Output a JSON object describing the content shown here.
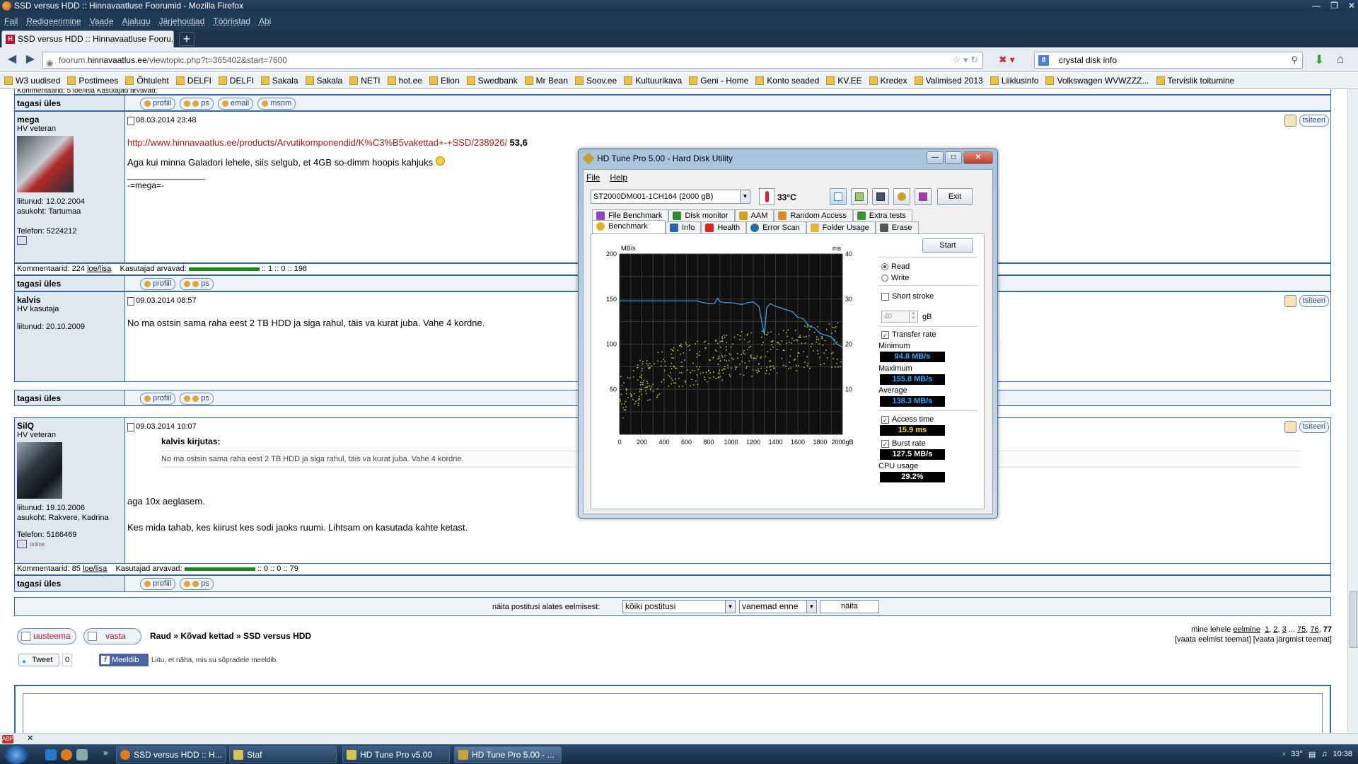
{
  "browser": {
    "title": "SSD versus HDD :: Hinnavaatluse Foorumid - Mozilla Firefox",
    "menu": [
      "Fail",
      "Redigeerimine",
      "Vaade",
      "Ajalugu",
      "Järjehoidjad",
      "Tööriistad",
      "Abi"
    ],
    "tab_title": "SSD versus HDD :: Hinnavaatluse Fooru...",
    "url_prefix": "foorum.",
    "url_domain": "hinnavaatlus.ee",
    "url_rest": "/viewtopic.php?t=365402&start=7600",
    "search_engine": "8",
    "search_text": "crystal disk info",
    "bookmarks": [
      "W3 uudised",
      "Postimees",
      "Õhtuleht",
      "DELFI",
      "DELFI",
      "Sakala",
      "Sakala",
      "NETI",
      "hot.ee",
      "Elion",
      "Swedbank",
      "Mr Bean",
      "Soov.ee",
      "Kultuurikava",
      "Geni - Home",
      "Konto seaded",
      "KV.EE",
      "Kredex",
      "Valimised 2013",
      "Liiklusinfo",
      "Volkswagen WVWZZZ...",
      "Tervislik toitumine"
    ]
  },
  "forum": {
    "top_partial": "Kommentaarid: 5 loe/lisa     Kasutajad arvavad:",
    "tagasi": "tagasi üles",
    "btn_profiil": "profiil",
    "btn_ps": "ps",
    "btn_email": "email",
    "btn_msnm": "msnm",
    "btn_tsiteeri": "tsiteeri",
    "posts": [
      {
        "user": "mega",
        "rank": "HV veteran",
        "joined": "liitunud: 12.02.2004",
        "location": "asukoht: Tartumaa",
        "phone": "Telefon: 5224212",
        "date": "08.03.2014 23:48",
        "link": "http://www.hinnavaatlus.ee/products/Arvutikomponendid/K%C3%B5vakettad+-+SSD/238926/",
        "link_tail": "53,6",
        "text": "Aga kui minna Galadori lehele, siis selgub, et 4GB so-dimm hoopis kahjuks",
        "sig_line": "__________________",
        "sig": "-=mega=-",
        "comments": "Kommentaarid: 224",
        "loe": "loe/lisa",
        "kasutajad": "Kasutajad arvavad:",
        "votes": ":: 1 :: 0 :: 198"
      },
      {
        "user": "kalvis",
        "rank": "HV kasutaja",
        "joined": "liitunud: 20.10.2009",
        "date": "09.03.2014 08:57",
        "text": "No ma ostsin sama raha eest 2 TB HDD ja siga rahul, täis va kurat juba. Vahe 4 kordne."
      },
      {
        "user": "SilQ",
        "rank": "HV veteran",
        "joined": "liitunud: 19.10.2006",
        "location": "asukoht: Rakvere, Kadrina",
        "phone": "Telefon: 5166469",
        "online": "online",
        "date": "09.03.2014 10:07",
        "quote_header": "kalvis kirjutas:",
        "quote_text": "No ma ostsin sama raha eest 2 TB HDD ja siga rahul, täis va kurat juba. Vahe 4 kordne.",
        "text1": "aga 10x aeglasem.",
        "text2": "Kes mida tahab, kes kiirust kes sodi jaoks ruumi. Lihtsam on kasutada kahte ketast.",
        "comments": "Kommentaarid: 85",
        "loe": "loe/lisa",
        "kasutajad": "Kasutajad arvavad:",
        "votes": ":: 0 :: 0 :: 79"
      }
    ],
    "filter_label": "näita postitusi alates eelmisest:",
    "filter_value": "kõiki postitusi",
    "order_value": "vanemad enne",
    "naita": "näita",
    "uusteema": "uusteema",
    "vasta": "vasta",
    "crumbs": [
      "Raud",
      "Kõvad kettad",
      "SSD versus HDD"
    ],
    "page_prefix": "mine lehele",
    "page_prev": "eelmine",
    "page_links": [
      "1",
      "2",
      "3",
      "75",
      "76"
    ],
    "page_current": "77",
    "topic_nav": "[vaata eelmist teemat] [vaata järgmist teemat]",
    "tweet": "Tweet",
    "tweet_count": "0",
    "fb_btn": "Meeldib",
    "fb_text": "Liitu, et näha, mis su sõpradele meeldib."
  },
  "hdtune": {
    "title": "HD Tune Pro 5.00 - Hard Disk Utility",
    "menu": [
      "File",
      "Help"
    ],
    "drive": "ST2000DM001-1CH164 (2000 gB)",
    "temp": "33°C",
    "exit": "Exit",
    "tabs_row1": [
      "File Benchmark",
      "Disk monitor",
      "AAM",
      "Random Access",
      "Extra tests"
    ],
    "tabs_row2": [
      "Benchmark",
      "Info",
      "Health",
      "Error Scan",
      "Folder Usage",
      "Erase"
    ],
    "start": "Start",
    "read": "Read",
    "write": "Write",
    "short_stroke": "Short stroke",
    "stroke_value": "40",
    "stroke_unit": "gB",
    "transfer_rate": "Transfer rate",
    "minimum_label": "Minimum",
    "minimum": "94.8 MB/s",
    "maximum_label": "Maximum",
    "maximum": "155.8 MB/s",
    "average_label": "Average",
    "average": "138.3 MB/s",
    "access_time_label": "Access time",
    "access_time": "15.9 ms",
    "burst_label": "Burst rate",
    "burst": "127.5 MB/s",
    "cpu_label": "CPU usage",
    "cpu": "29.2%"
  },
  "chart_data": {
    "type": "line",
    "y_left_label": "MB/s",
    "y_right_label": "ms",
    "x_ticks": [
      "0",
      "200",
      "400",
      "600",
      "800",
      "1000",
      "1200",
      "1400",
      "1600",
      "1800",
      "2000gB"
    ],
    "y_left_ticks": [
      "200",
      "150",
      "100",
      "50"
    ],
    "y_right_ticks": [
      "40",
      "30",
      "20",
      "10"
    ],
    "xlim": [
      0,
      2000
    ],
    "ylim_left": [
      0,
      200
    ],
    "ylim_right": [
      0,
      40
    ],
    "series": [
      {
        "x": [
          0,
          100,
          200,
          300,
          400,
          500,
          600,
          700,
          720,
          750,
          800,
          850,
          880,
          900,
          950,
          1000,
          1050,
          1100,
          1150,
          1200,
          1250,
          1300,
          1320,
          1350,
          1400,
          1450,
          1500,
          1550,
          1600,
          1650,
          1700,
          1750,
          1800,
          1850,
          1900,
          1950,
          2000
        ],
        "values": [
          148,
          148,
          148,
          148,
          148,
          148,
          148,
          148,
          147,
          146,
          145,
          145,
          151,
          147,
          146,
          146,
          145,
          144,
          146,
          147,
          142,
          110,
          140,
          145,
          142,
          140,
          138,
          136,
          130,
          128,
          120,
          118,
          112,
          110,
          108,
          100,
          97
        ]
      },
      {
        "x": [
          0,
          100,
          200,
          300,
          400,
          500,
          600,
          700,
          800,
          900,
          1000,
          1100,
          1200,
          1300,
          1400,
          1500,
          1600,
          1700,
          1800,
          1900,
          2000
        ],
        "values": [
          8,
          10,
          12,
          13,
          14,
          15,
          15.5,
          16,
          16.5,
          17,
          17.5,
          18,
          18,
          18.5,
          18.5,
          19,
          19,
          19.5,
          19.5,
          20,
          20
        ]
      }
    ],
    "grid": true
  },
  "taskbar": {
    "tasks": [
      "SSD versus HDD :: H...",
      "Staf",
      "HD Tune Pro v5.00",
      "HD Tune Pro 5.00 - ..."
    ],
    "tray_temp": "33°",
    "clock": "10:38"
  }
}
